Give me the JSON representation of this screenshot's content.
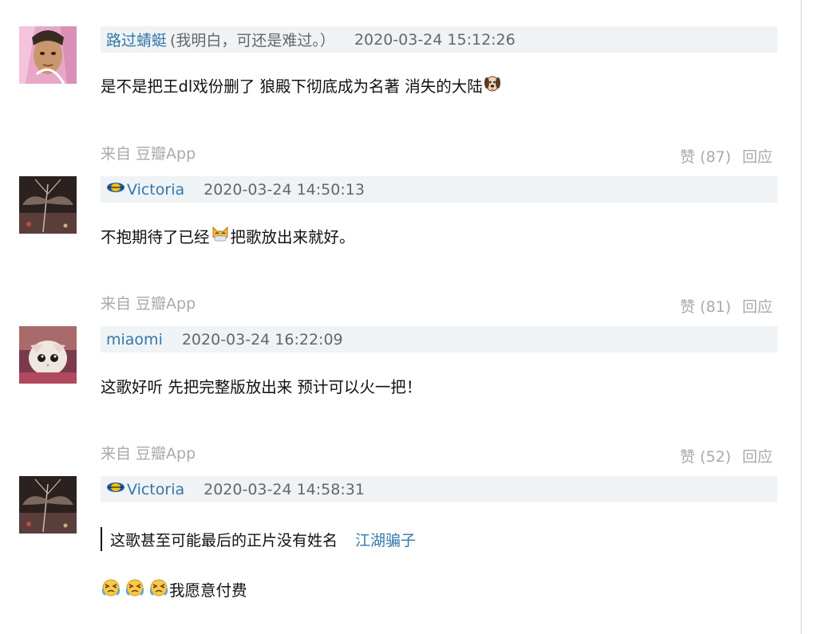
{
  "comments": [
    {
      "author": "路过蜻蜓",
      "note": "(我明白，可还是难过。）",
      "time": "2020-03-24 15:12:26",
      "text": "是不是把王dl戏份删了 狼殿下彻底成为名著 消失的大陆",
      "emoji": "dog-face-icon",
      "source": "来自 豆瓣App",
      "likes": "赞 (87)",
      "reply": "回应"
    },
    {
      "author": "Victoria",
      "time": "2020-03-24 14:50:13",
      "text_before": "不抱期待了已经",
      "text_after": "把歌放出来就好。",
      "emoji": "cat-face-icon",
      "source": "来自 豆瓣App",
      "likes": "赞 (81)",
      "reply": "回应"
    },
    {
      "author": "miaomi",
      "time": "2020-03-24 16:22:09",
      "text": "这歌好听 先把完整版放出来 预计可以火一把！",
      "source": "来自 豆瓣App",
      "likes": "赞 (52)",
      "reply": "回应"
    },
    {
      "author": "Victoria",
      "time": "2020-03-24 14:58:31",
      "quote_text": "这歌甚至可能最后的正片没有姓名",
      "quote_author": "江湖骗子",
      "text": "我愿意付费",
      "emoji": "crying-face-icon"
    }
  ],
  "colors": {
    "link": "#3377aa",
    "meta": "#aaaaaa",
    "header_bg": "#f0f3f5"
  }
}
